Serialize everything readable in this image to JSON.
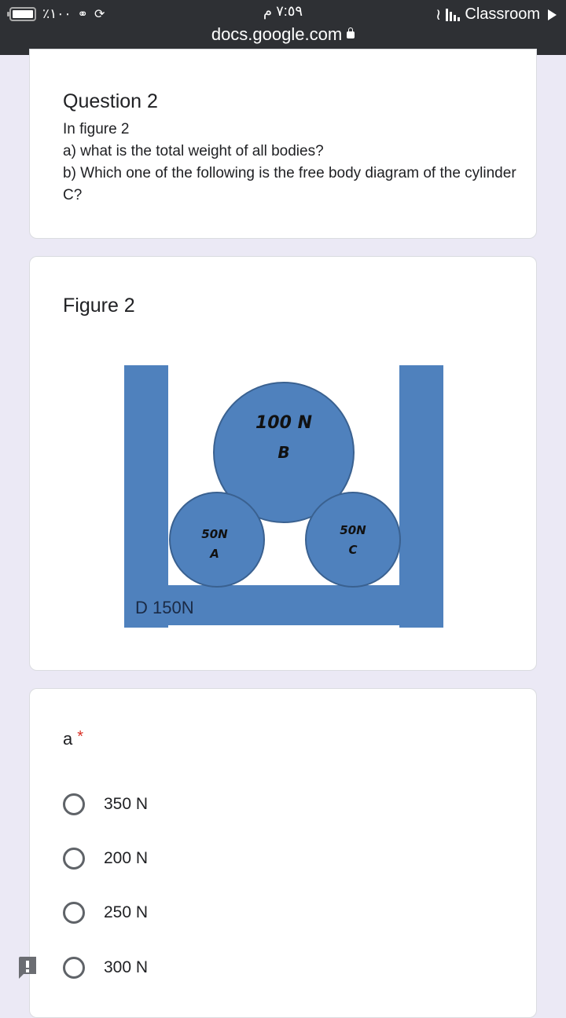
{
  "status_bar": {
    "battery_text": "٪١٠٠",
    "time": "٧:٥٩ م",
    "url": "docs.google.com",
    "carrier": "Classroom",
    "icons": [
      "battery-icon",
      "headphones-icon",
      "rotation-lock-icon",
      "wifi-icon",
      "signal-icon",
      "lock-icon",
      "play-icon"
    ]
  },
  "question_card": {
    "title": "Question 2",
    "lines": [
      "In figure 2",
      "a) what is the total weight of all bodies?",
      "b) Which one of the following is the free body diagram of the cylinder C?"
    ]
  },
  "figure_card": {
    "title": "Figure 2",
    "diagram": {
      "fill_color": "#4f81bd",
      "stroke_color": "#3a6190",
      "bodies": [
        {
          "name": "B",
          "weight": "100 N"
        },
        {
          "name": "A",
          "weight": "50N"
        },
        {
          "name": "C",
          "weight": "50N"
        }
      ],
      "container_label": "D 150N"
    }
  },
  "answer_card": {
    "label": "a",
    "required_mark": "*",
    "options": [
      "350 N",
      "200 N",
      "250 N",
      "300 N"
    ]
  }
}
